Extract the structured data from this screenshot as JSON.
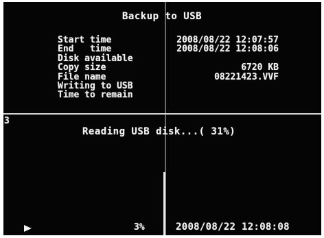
{
  "title": "Backup to USB",
  "info": {
    "rows": [
      {
        "label": "Start time",
        "value": "2008/08/22 12:07:57"
      },
      {
        "label": "End   time",
        "value": "2008/08/22 12:08:06"
      },
      {
        "label": "Disk available",
        "value": ""
      },
      {
        "label": "Copy size",
        "value": "6720 KB"
      },
      {
        "label": "File name",
        "value": "08221423.VVF"
      },
      {
        "label": "Writing to USB",
        "value": ""
      },
      {
        "label": "Time to remain",
        "value": ""
      }
    ]
  },
  "channel_number": "3",
  "status_text": "Reading USB disk...( 31%)",
  "status_progress_percent": 31,
  "footer": {
    "play_icon": "play-icon",
    "percent": "3%",
    "datetime": "2008/08/22 12:08:08"
  },
  "colors": {
    "background": "#050505",
    "text": "#f2f2f2",
    "divider": "#d8d8d8"
  }
}
